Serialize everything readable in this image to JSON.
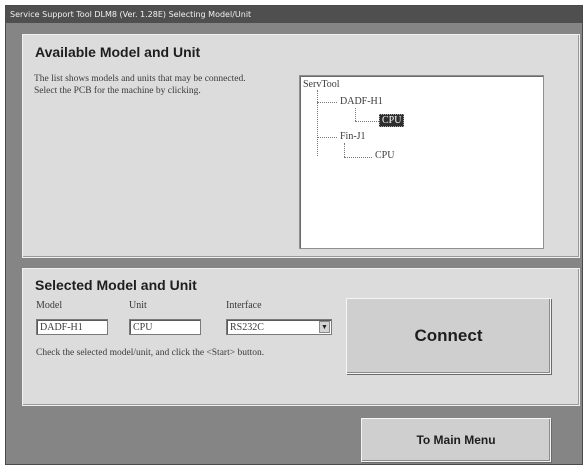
{
  "window": {
    "title": "Service Support Tool DLM8 (Ver. 1.28E) Selecting Model/Unit"
  },
  "available": {
    "heading": "Available Model and Unit",
    "description": "The list shows models and units that may be connected. Select the PCB for the machine by clicking.",
    "tree": {
      "root": "ServTool",
      "model1": "DADF-H1",
      "model1_unit": "CPU",
      "model2": "Fin-J1",
      "model2_unit": "CPU"
    }
  },
  "selected": {
    "heading": "Selected Model and Unit",
    "model_label": "Model",
    "model_value": "DADF-H1",
    "unit_label": "Unit",
    "unit_value": "CPU",
    "interface_label": "Interface",
    "interface_value": "RS232C",
    "instruction": "Check the selected model/unit, and click the <Start> button."
  },
  "buttons": {
    "connect": "Connect",
    "main_menu": "To Main Menu"
  }
}
